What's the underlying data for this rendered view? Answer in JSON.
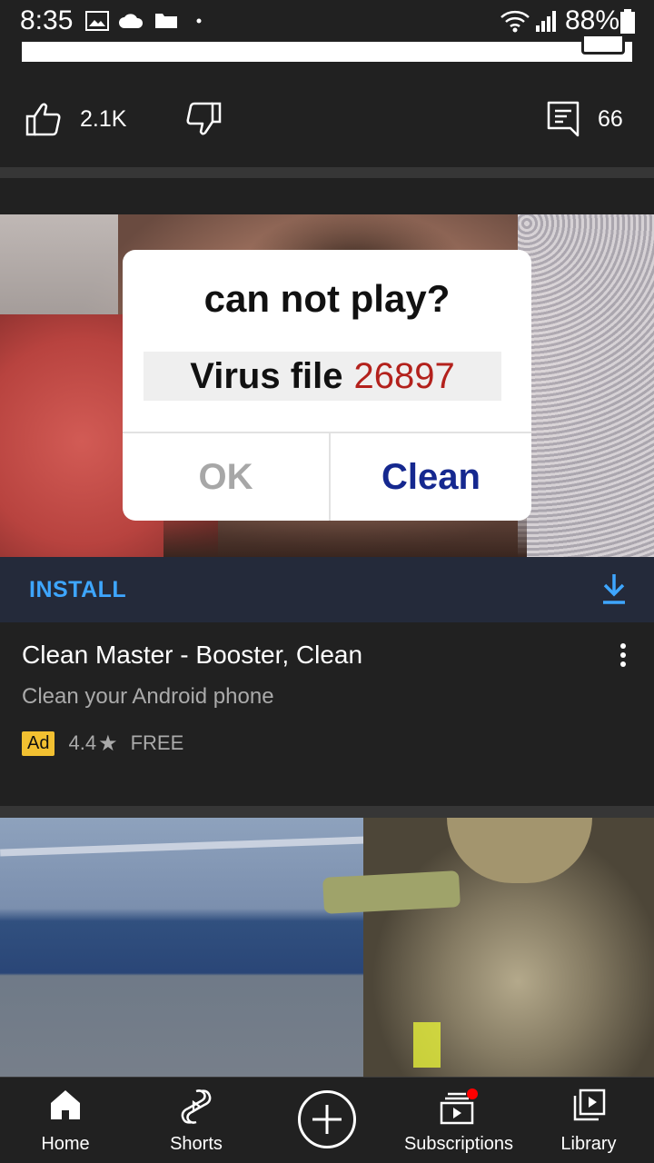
{
  "status_bar": {
    "time": "8:35",
    "battery": "88%"
  },
  "actions": {
    "like_count": "2.1K",
    "comment_count": "66"
  },
  "ad": {
    "dialog_title": "can not play?",
    "dialog_virus_text": "Virus file",
    "dialog_virus_number": "26897",
    "dialog_ok": "OK",
    "dialog_clean": "Clean",
    "install_label": "INSTALL",
    "title": "Clean Master - Booster, Clean",
    "subtitle": "Clean your Android phone",
    "badge": "Ad",
    "rating": "4.4",
    "price": "FREE"
  },
  "bottom_nav": {
    "home": "Home",
    "shorts": "Shorts",
    "subscriptions": "Subscriptions",
    "library": "Library"
  },
  "colors": {
    "background": "#212121",
    "accent_blue": "#3ea6ff",
    "ad_badge": "#f2c031",
    "notification_dot": "#ff0000"
  }
}
